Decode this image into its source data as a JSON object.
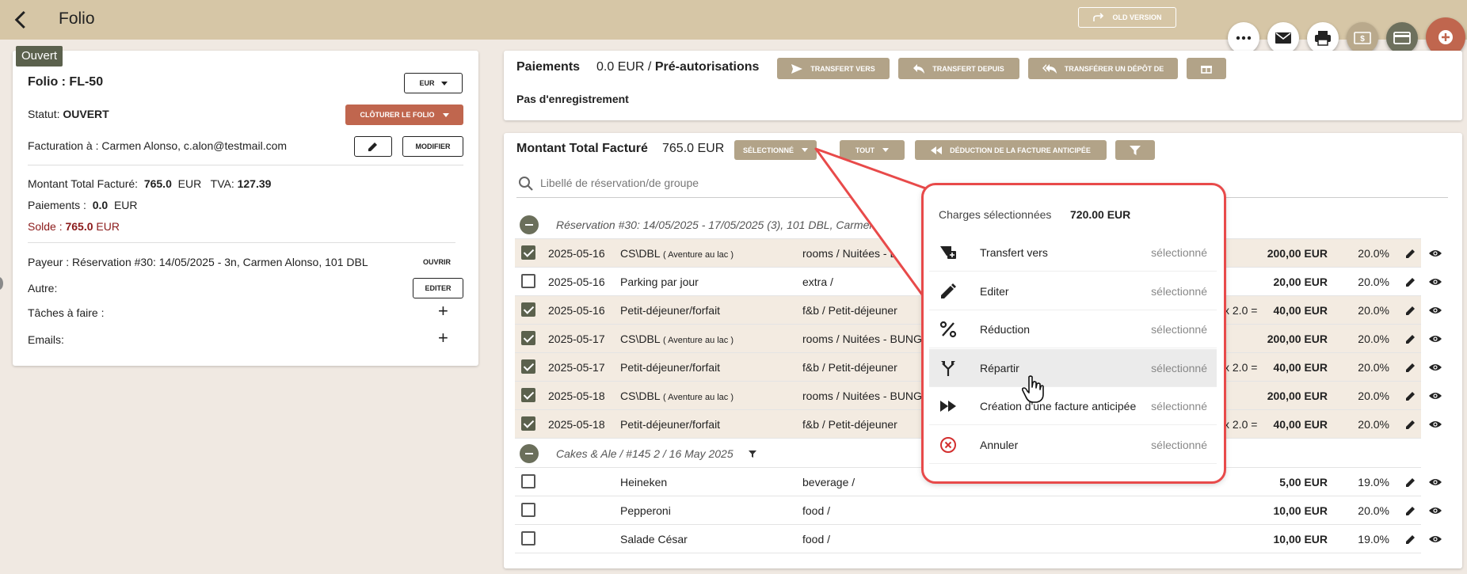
{
  "header": {
    "title": "Folio",
    "old_version": "OLD VERSION"
  },
  "left": {
    "badge": "Ouvert",
    "folio_title": "Folio : FL-50",
    "currency": "EUR",
    "status_label": "Statut:",
    "status_value": "OUVERT",
    "close_button": "CLÔTURER LE FOLIO",
    "billing_label": "Facturation à :",
    "billing_value": "Carmen Alonso, c.alon@testmail.com",
    "modify_button": "MODIFIER",
    "total_label": "Montant Total Facturé:",
    "total_value": "765.0",
    "total_currency": "EUR",
    "tva_label": "TVA:",
    "tva_value": "127.39",
    "payments_label": "Paiements :",
    "payments_value": "0.0",
    "payments_currency": "EUR",
    "balance_label": "Solde :",
    "balance_value": "765.0",
    "balance_currency": "EUR",
    "payer_label": "Payeur :",
    "payer_value": "Réservation #30: 14/05/2025 - 3n, Carmen Alonso, 101 DBL",
    "open_button": "OUVRIR",
    "other_label": "Autre:",
    "edit_button": "EDITER",
    "tasks_label": "Tâches à faire :",
    "emails_label": "Emails:",
    "plus": "+"
  },
  "payments": {
    "title": "Paiements",
    "amount": "0.0 EUR",
    "separator": "/",
    "preauth": "Pré-autorisations",
    "btn_transfer_to": "TRANSFERT VERS",
    "btn_transfer_from": "TRANSFERT DEPUIS",
    "btn_transfer_deposit": "TRANSFÉRER UN DÉPÔT DE",
    "no_record": "Pas d'enregistrement"
  },
  "charges": {
    "title": "Montant Total Facturé",
    "amount": "765.0 EUR",
    "btn_selected": "SÉLECTIONNÉ",
    "btn_all": "TOUT",
    "btn_deduction": "DÉDUCTION DE LA FACTURE ANTICIPÉE",
    "search_placeholder": "Libellé de réservation/de groupe",
    "group1": "Réservation #30: 14/05/2025 - 17/05/2025 (3), 101 DBL, Carmen Alonso, i",
    "group2": "Cakes & Ale / #145 2 / 16 May 2025",
    "rows": [
      {
        "checked": true,
        "date": "2025-05-16",
        "name": "CS\\DBL",
        "note": "( Aventure au lac )",
        "category": "rooms / Nuitées - BUNG",
        "qty": "",
        "amount": "200,00 EUR",
        "tax": "20.0%"
      },
      {
        "checked": false,
        "date": "2025-05-16",
        "name": "Parking par jour",
        "note": "",
        "category": "extra /",
        "qty": "",
        "amount": "20,00 EUR",
        "tax": "20.0%"
      },
      {
        "checked": true,
        "date": "2025-05-16",
        "name": "Petit-déjeuner/forfait",
        "note": "",
        "category": "f&b / Petit-déjeuner",
        "qty": "x 2.0 =",
        "amount": "40,00 EUR",
        "tax": "20.0%"
      },
      {
        "checked": true,
        "date": "2025-05-17",
        "name": "CS\\DBL",
        "note": "( Aventure au lac )",
        "category": "rooms / Nuitées - BUNG",
        "qty": "",
        "amount": "200,00 EUR",
        "tax": "20.0%"
      },
      {
        "checked": true,
        "date": "2025-05-17",
        "name": "Petit-déjeuner/forfait",
        "note": "",
        "category": "f&b / Petit-déjeuner",
        "qty": "x 2.0 =",
        "amount": "40,00 EUR",
        "tax": "20.0%"
      },
      {
        "checked": true,
        "date": "2025-05-18",
        "name": "CS\\DBL",
        "note": "( Aventure au lac )",
        "category": "rooms / Nuitées - BUNG",
        "qty": "",
        "amount": "200,00 EUR",
        "tax": "20.0%"
      },
      {
        "checked": true,
        "date": "2025-05-18",
        "name": "Petit-déjeuner/forfait",
        "note": "",
        "category": "f&b / Petit-déjeuner",
        "qty": "x 2.0 =",
        "amount": "40,00 EUR",
        "tax": "20.0%"
      }
    ],
    "rows2": [
      {
        "checked": false,
        "date": "",
        "name": "Heineken",
        "note": "",
        "category": "beverage /",
        "qty": "",
        "amount": "5,00 EUR",
        "tax": "19.0%"
      },
      {
        "checked": false,
        "date": "",
        "name": "Pepperoni",
        "note": "",
        "category": "food /",
        "qty": "",
        "amount": "10,00 EUR",
        "tax": "20.0%"
      },
      {
        "checked": false,
        "date": "",
        "name": "Salade César",
        "note": "",
        "category": "food /",
        "qty": "",
        "amount": "10,00 EUR",
        "tax": "19.0%"
      }
    ]
  },
  "dropdown": {
    "header_label": "Charges sélectionnées",
    "header_value": "720.00 EUR",
    "items": [
      {
        "icon": "transfer-icon",
        "label": "Transfert vers",
        "suffix": "sélectionné"
      },
      {
        "icon": "pencil-icon",
        "label": "Editer",
        "suffix": "sélectionné"
      },
      {
        "icon": "percent-icon",
        "label": "Réduction",
        "suffix": "sélectionné"
      },
      {
        "icon": "split-icon",
        "label": "Répartir",
        "suffix": "sélectionné"
      },
      {
        "icon": "fast-forward-icon",
        "label": "Création d'une facture anticipée",
        "suffix": "sélectionné"
      },
      {
        "icon": "cancel-icon",
        "label": "Annuler",
        "suffix": "sélectionné"
      }
    ]
  },
  "colors": {
    "header": "#d6c6a6",
    "accent": "#c0664e",
    "khaki": "#b2a388",
    "dark_green": "#5b614d",
    "callout": "#e84a4a",
    "balance": "#8b1a1a"
  }
}
